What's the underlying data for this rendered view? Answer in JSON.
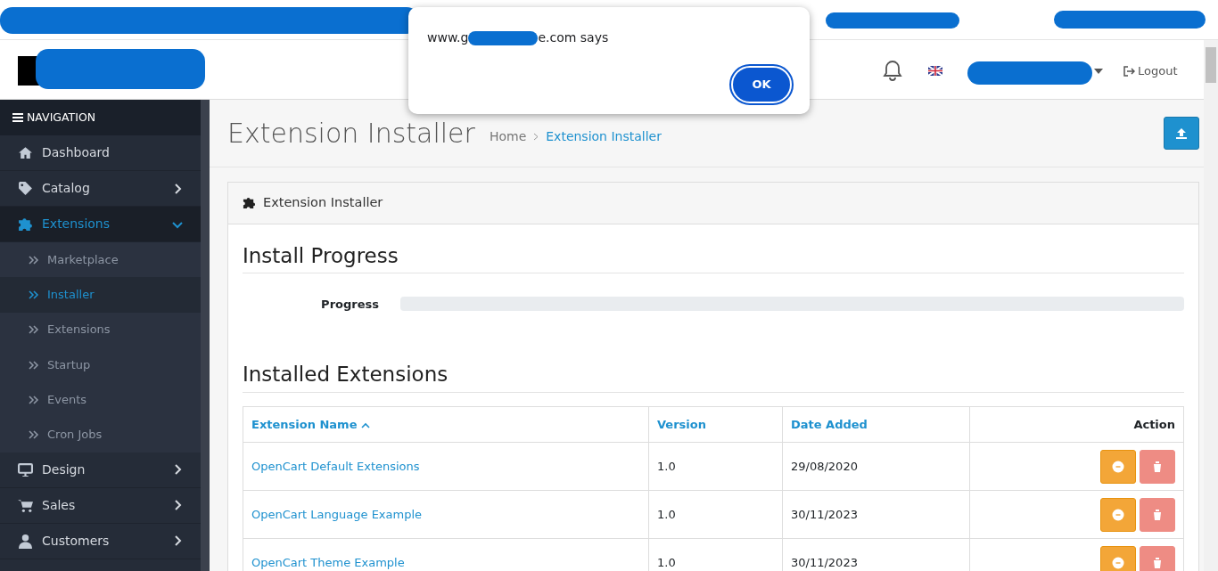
{
  "dialog": {
    "title_parts": [
      "www.g",
      "e.com says"
    ],
    "button": "OK"
  },
  "header": {
    "logout": "Logout"
  },
  "sidebar": {
    "heading": "NAVIGATION",
    "items": [
      {
        "label": "Dashboard",
        "has_children": false,
        "selected": false
      },
      {
        "label": "Catalog",
        "has_children": true,
        "expanded": false,
        "selected": false
      },
      {
        "label": "Extensions",
        "has_children": true,
        "expanded": true,
        "selected": true,
        "children": [
          {
            "label": "Marketplace",
            "selected": false
          },
          {
            "label": "Installer",
            "selected": true
          },
          {
            "label": "Extensions",
            "selected": false
          },
          {
            "label": "Startup",
            "selected": false
          },
          {
            "label": "Events",
            "selected": false
          },
          {
            "label": "Cron Jobs",
            "selected": false
          }
        ]
      },
      {
        "label": "Design",
        "has_children": true,
        "expanded": false,
        "selected": false
      },
      {
        "label": "Sales",
        "has_children": true,
        "expanded": false,
        "selected": false
      },
      {
        "label": "Customers",
        "has_children": true,
        "expanded": false,
        "selected": false
      }
    ]
  },
  "page": {
    "title": "Extension Installer",
    "breadcrumbs": [
      "Home",
      "Extension Installer"
    ]
  },
  "card": {
    "title": "Extension Installer",
    "progress_heading": "Install Progress",
    "progress_label": "Progress",
    "level": 0,
    "installed_heading": "Installed Extensions"
  },
  "table": {
    "columns": [
      {
        "label": "Extension Name",
        "sorted": true
      },
      {
        "label": "Version"
      },
      {
        "label": "Date Added"
      },
      {
        "label": "Action"
      }
    ],
    "rows": [
      {
        "name": "OpenCart Default Extensions",
        "version": "1.0",
        "date": "29/08/2020"
      },
      {
        "name": "OpenCart Language Example",
        "version": "1.0",
        "date": "30/11/2023"
      },
      {
        "name": "OpenCart Theme Example",
        "version": "1.0",
        "date": "30/11/2023"
      }
    ]
  }
}
